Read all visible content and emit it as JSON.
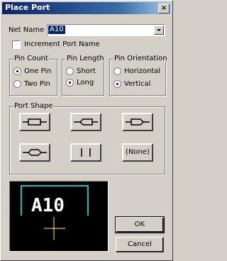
{
  "window": {
    "title": "Place Port",
    "close_glyph": "×"
  },
  "net_name": {
    "label": "Net Name",
    "value": "A10"
  },
  "increment": {
    "label": "Increment Port Name",
    "checked": false
  },
  "pin_count": {
    "title": "Pin Count",
    "options": [
      "One Pin",
      "Two Pin"
    ],
    "selected": "One Pin"
  },
  "pin_length": {
    "title": "Pin Length",
    "options": [
      "Short",
      "Long"
    ],
    "selected": "Long"
  },
  "pin_orientation": {
    "title": "Pin Orientation",
    "options": [
      "Horizontal",
      "Vertical"
    ],
    "selected": "Vertical"
  },
  "port_shape": {
    "title": "Port Shape",
    "shapes": [
      "bidirectional-port-icon",
      "input-port-icon",
      "output-port-icon",
      "diamond-port-icon",
      "bar-port-icon",
      "none"
    ],
    "none_label": "(None)"
  },
  "preview": {
    "net_label": "A10",
    "colors": {
      "background": "#000000",
      "port": "#00ffff",
      "text": "#ffffff",
      "cursor": "#ffff00"
    }
  },
  "buttons": {
    "ok": "OK",
    "cancel": "Cancel"
  }
}
